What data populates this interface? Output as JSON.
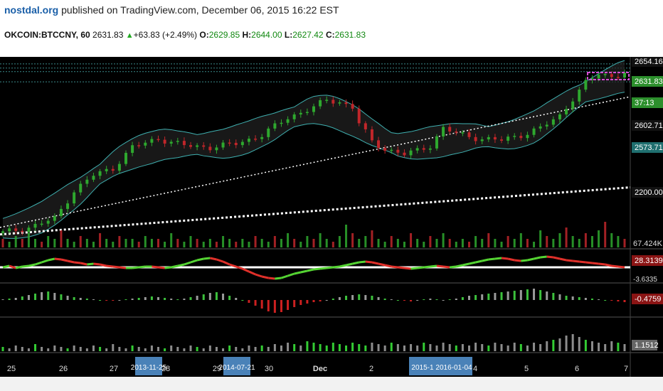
{
  "header": {
    "site": "nostdal.org",
    "published": " published on TradingView.com, December 06, 2015 16:22 EST"
  },
  "ticker": {
    "symbol": "OKCOIN:BTCCNY, 60",
    "last": "2631.83",
    "change": "+63.83 (+2.49%)",
    "open_label": "O:",
    "open": "2629.85",
    "high_label": "H:",
    "high": "2644.00",
    "low_label": "L:",
    "low": "2627.42",
    "close_label": "C:",
    "close": "2631.83"
  },
  "colors": {
    "background": "#000000",
    "up": "#2ea82e",
    "down": "#c0262a",
    "band": "#3fb0b0",
    "axis_label_bg": "#1f6f6f",
    "marker": "#d34fd3",
    "hline": "#3a8a8a"
  },
  "chart_data": {
    "type": "candlestick",
    "x_ticks": [
      "25",
      "26",
      "27",
      "28",
      "29",
      "30",
      "Dec",
      "2",
      "3",
      "4",
      "5",
      "6",
      "7"
    ],
    "date_markers": [
      "2013-11-25",
      "2014-07-21",
      "2015-1",
      "2016-01-04"
    ],
    "price_axis_labels": [
      "2654.16",
      "2631.83",
      "37:13",
      "2602.71",
      "2573.71",
      "2200.00"
    ],
    "price_range": [
      2140,
      2662
    ],
    "price_path": [
      [
        0,
        2170
      ],
      [
        4,
        2185
      ],
      [
        8,
        2210
      ],
      [
        11,
        2290
      ],
      [
        14,
        2335
      ],
      [
        17,
        2355
      ],
      [
        20,
        2415
      ],
      [
        24,
        2440
      ],
      [
        28,
        2420
      ],
      [
        32,
        2415
      ],
      [
        36,
        2425
      ],
      [
        40,
        2450
      ],
      [
        44,
        2500
      ],
      [
        48,
        2530
      ],
      [
        50,
        2550
      ],
      [
        52,
        2545
      ],
      [
        54,
        2530
      ],
      [
        55,
        2485
      ],
      [
        57,
        2430
      ],
      [
        59,
        2410
      ],
      [
        62,
        2395
      ],
      [
        64,
        2405
      ],
      [
        66,
        2420
      ],
      [
        68,
        2470
      ],
      [
        70,
        2455
      ],
      [
        72,
        2445
      ],
      [
        74,
        2440
      ],
      [
        77,
        2435
      ],
      [
        80,
        2450
      ],
      [
        83,
        2470
      ],
      [
        86,
        2505
      ],
      [
        88,
        2555
      ],
      [
        90,
        2600
      ],
      [
        92,
        2625
      ],
      [
        94,
        2618
      ],
      [
        96,
        2630
      ],
      [
        97,
        2632
      ]
    ],
    "horizontal_levels": [
      2654.16,
      2642,
      2631.83,
      2602.71
    ],
    "volume_axis_label": "67.424K",
    "volume": [
      0.3,
      0.2,
      0.4,
      0.3,
      0.5,
      0.3,
      0.2,
      0.4,
      0.3,
      0.6,
      0.3,
      0.2,
      0.4,
      0.3,
      0.2,
      0.5,
      0.3,
      0.2,
      0.4,
      0.3,
      0.3,
      0.2,
      0.4,
      0.3,
      0.3,
      0.2,
      0.5,
      0.3,
      0.2,
      0.4,
      0.3,
      0.2,
      0.3,
      0.2,
      0.4,
      0.3,
      0.2,
      0.3,
      0.2,
      0.4,
      0.3,
      0.2,
      0.4,
      0.3,
      0.5,
      0.3,
      0.2,
      0.4,
      0.3,
      0.5,
      0.3,
      0.2,
      0.4,
      0.8,
      0.5,
      0.3,
      0.4,
      0.6,
      0.3,
      0.2,
      0.4,
      0.3,
      0.2,
      0.5,
      0.3,
      0.2,
      0.4,
      0.3,
      0.5,
      0.3,
      0.2,
      0.3,
      0.2,
      0.4,
      0.3,
      0.5,
      0.3,
      0.2,
      0.4,
      0.3,
      0.5,
      0.3,
      0.2,
      0.6,
      0.4,
      0.3,
      0.5,
      0.7,
      0.4,
      0.3,
      0.5,
      0.4,
      0.6,
      0.9,
      0.5,
      0.4,
      0.3
    ],
    "oscillator_axis_labels": [
      "28.3139",
      "-3.6335"
    ],
    "oscillator": [
      0.0,
      0.1,
      -0.05,
      0.05,
      0.1,
      0.2,
      0.35,
      0.5,
      0.6,
      0.55,
      0.45,
      0.35,
      0.3,
      0.2,
      0.25,
      0.2,
      0.1,
      0.05,
      0.0,
      -0.05,
      -0.05,
      0.0,
      0.05,
      0.05,
      0.0,
      -0.05,
      0.0,
      0.1,
      0.2,
      0.35,
      0.5,
      0.6,
      0.65,
      0.55,
      0.4,
      0.2,
      0.05,
      -0.1,
      -0.3,
      -0.5,
      -0.65,
      -0.75,
      -0.8,
      -0.75,
      -0.6,
      -0.45,
      -0.35,
      -0.25,
      -0.15,
      -0.1,
      -0.05,
      0.0,
      0.05,
      0.15,
      0.25,
      0.35,
      0.4,
      0.35,
      0.25,
      0.15,
      0.05,
      0.0,
      -0.05,
      -0.1,
      -0.05,
      0.0,
      0.05,
      0.1,
      0.05,
      0.0,
      0.05,
      0.15,
      0.25,
      0.35,
      0.45,
      0.55,
      0.6,
      0.65,
      0.6,
      0.5,
      0.45,
      0.5,
      0.6,
      0.7,
      0.75,
      0.7,
      0.6,
      0.5,
      0.45,
      0.4,
      0.35,
      0.3,
      0.25,
      0.2,
      0.1,
      0.05,
      0.0
    ],
    "histogram_axis_label": "-0.4759",
    "histogram": [
      0.05,
      0.1,
      0.15,
      0.25,
      0.35,
      0.45,
      0.55,
      0.6,
      0.5,
      0.4,
      0.3,
      0.2,
      0.15,
      0.1,
      0.05,
      0.0,
      -0.05,
      -0.05,
      0.0,
      0.05,
      0.1,
      0.15,
      0.2,
      0.25,
      0.2,
      0.15,
      0.1,
      0.05,
      0.1,
      0.2,
      0.3,
      0.4,
      0.5,
      0.55,
      0.45,
      0.3,
      0.15,
      0.0,
      -0.2,
      -0.4,
      -0.6,
      -0.8,
      -0.9,
      -0.85,
      -0.7,
      -0.5,
      -0.35,
      -0.25,
      -0.15,
      -0.1,
      0.0,
      0.1,
      0.2,
      0.3,
      0.35,
      0.4,
      0.35,
      0.3,
      0.2,
      0.1,
      0.05,
      0.0,
      -0.05,
      -0.1,
      0.0,
      0.05,
      0.1,
      0.05,
      0.0,
      0.05,
      0.1,
      0.2,
      0.3,
      0.35,
      0.4,
      0.45,
      0.5,
      0.55,
      0.6,
      0.65,
      0.7,
      0.75,
      0.8,
      0.7,
      0.6,
      0.5,
      0.4,
      0.3,
      0.25,
      0.2,
      0.15,
      0.1,
      0.05,
      0.0,
      -0.05,
      -0.1,
      -0.15
    ],
    "volume2_axis_label": "1.1512",
    "volume2": [
      0.15,
      0.1,
      0.2,
      0.15,
      0.1,
      0.25,
      0.15,
      0.1,
      0.2,
      0.15,
      0.1,
      0.2,
      0.15,
      0.1,
      0.2,
      0.15,
      0.1,
      0.25,
      0.15,
      0.1,
      0.2,
      0.15,
      0.1,
      0.2,
      0.15,
      0.1,
      0.2,
      0.15,
      0.1,
      0.2,
      0.15,
      0.1,
      0.2,
      0.15,
      0.1,
      0.2,
      0.15,
      0.1,
      0.2,
      0.15,
      0.2,
      0.15,
      0.25,
      0.2,
      0.3,
      0.25,
      0.2,
      0.35,
      0.3,
      0.25,
      0.2,
      0.3,
      0.25,
      0.2,
      0.3,
      0.25,
      0.2,
      0.3,
      0.25,
      0.2,
      0.3,
      0.25,
      0.2,
      0.25,
      0.2,
      0.3,
      0.25,
      0.2,
      0.3,
      0.25,
      0.2,
      0.25,
      0.2,
      0.3,
      0.25,
      0.2,
      0.3,
      0.25,
      0.2,
      0.3,
      0.25,
      0.2,
      0.3,
      0.25,
      0.35,
      0.4,
      0.45,
      0.55,
      0.6,
      0.5,
      0.4,
      0.35,
      0.3,
      0.25,
      0.35,
      0.3,
      0.25
    ]
  }
}
